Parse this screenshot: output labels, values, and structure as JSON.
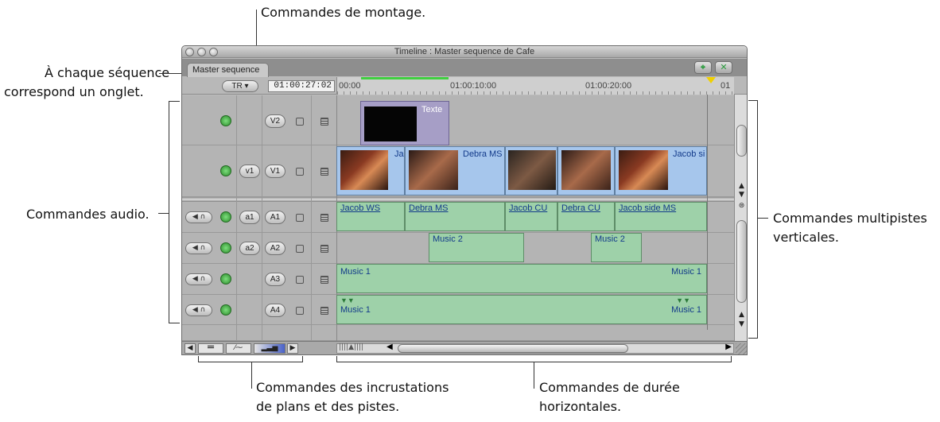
{
  "callouts": {
    "montage": "Commandes de montage.",
    "onglet_1": "À chaque séquence",
    "onglet_2": "correspond un onglet.",
    "audio": "Commandes audio.",
    "multipistes_1": "Commandes multipistes",
    "multipistes_2": "verticales.",
    "incrustations_1": "Commandes des incrustations",
    "incrustations_2": "de plans et des pistes.",
    "duree_1": "Commandes de durée",
    "duree_2": "horizontales."
  },
  "window": {
    "title": "Timeline : Master sequence de Cafe",
    "tab_label": "Master sequence",
    "tr_button": "TR ▾",
    "timecode": "01:00:27:02",
    "ruler_ticks": [
      "00:00",
      "01:00:10:00",
      "01:00:20:00",
      "01"
    ]
  },
  "tracks": {
    "video": [
      {
        "source": "",
        "target": "V2"
      },
      {
        "source": "v1",
        "target": "V1"
      }
    ],
    "audio": [
      {
        "source": "a1",
        "target": "A1"
      },
      {
        "source": "a2",
        "target": "A2"
      },
      {
        "source": "",
        "target": "A3"
      },
      {
        "source": "",
        "target": "A4"
      }
    ]
  },
  "clips": {
    "v2": {
      "label": "Texte"
    },
    "v1": [
      "Ja",
      "Debra MS",
      "Jacob si"
    ],
    "a1": [
      "Jacob WS",
      "Debra MS",
      "Jacob CU",
      "Debra CU",
      "Jacob side MS"
    ],
    "a2": [
      "Music 2",
      "Music 2"
    ],
    "a3": [
      "Music 1",
      "Music 1"
    ],
    "a4": [
      "Music 1",
      "Music 1"
    ]
  },
  "colors": {
    "video_clip": "#a6c6ec",
    "audio_clip": "#9ed1a9",
    "text_clip": "#a69ec6",
    "playhead": "#f0d000"
  },
  "icons": [
    "speaker-icon",
    "headphones-icon",
    "lock-icon",
    "monitor-icon",
    "zoom-icon",
    "snap-icon"
  ]
}
